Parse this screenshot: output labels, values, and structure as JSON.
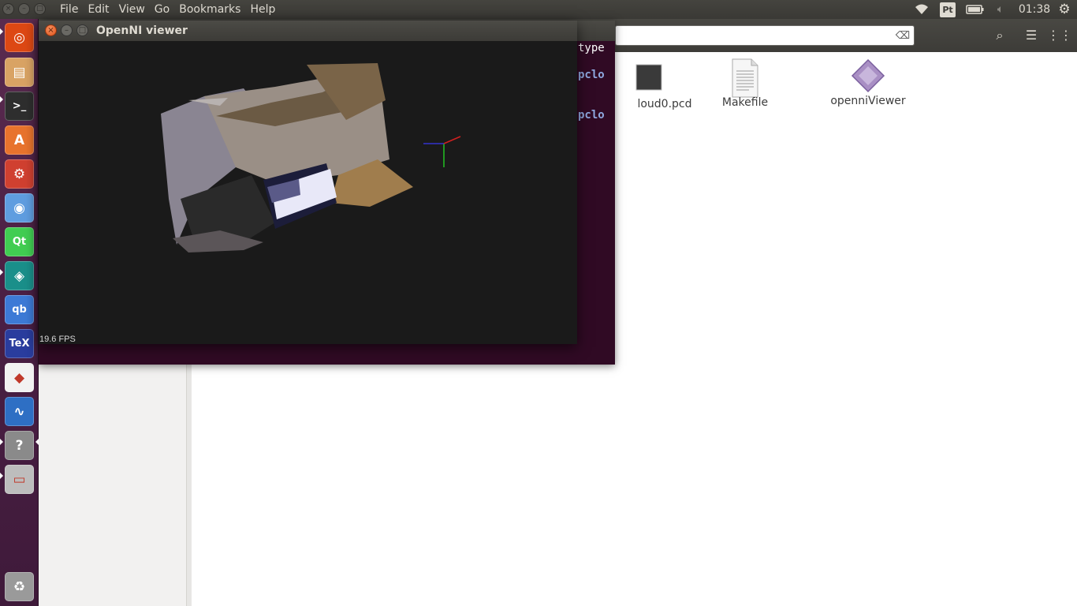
{
  "topbar": {
    "menus": [
      "File",
      "Edit",
      "View",
      "Go",
      "Bookmarks",
      "Help"
    ],
    "keyboard_layout": "Pt",
    "clock": "01:38",
    "icons": [
      "wifi-icon",
      "keyboard-layout-indicator",
      "battery-icon",
      "volume-muted-icon",
      "settings-gear-icon"
    ]
  },
  "launcher": {
    "items": [
      {
        "name": "dash-home",
        "glyph": "◎",
        "color": "#dd4814"
      },
      {
        "name": "files",
        "glyph": "▤",
        "color": "#d9a364"
      },
      {
        "name": "terminal",
        "glyph": ">_",
        "color": "#2e2e2e"
      },
      {
        "name": "software-center",
        "glyph": "A",
        "color": "#e8732d"
      },
      {
        "name": "system-settings",
        "glyph": "⚙",
        "color": "#d04030"
      },
      {
        "name": "chromium",
        "glyph": "◉",
        "color": "#5f9de0"
      },
      {
        "name": "qt-creator",
        "glyph": "Qt",
        "color": "#41cd52"
      },
      {
        "name": "gitkraken",
        "glyph": "◈",
        "color": "#1a8f8a"
      },
      {
        "name": "qbittorrent",
        "glyph": "qb",
        "color": "#3d7ad6"
      },
      {
        "name": "texmaker",
        "glyph": "TeX",
        "color": "#2a3d9e"
      },
      {
        "name": "document-viewer",
        "glyph": "◆",
        "color": "#f2f2f2"
      },
      {
        "name": "system-monitor",
        "glyph": "∿",
        "color": "#2e6fc4"
      },
      {
        "name": "help",
        "glyph": "?",
        "color": "#8a8a8a"
      },
      {
        "name": "drive",
        "glyph": "▭",
        "color": "#bdbdbd"
      }
    ],
    "trash_glyph": "♻"
  },
  "file_manager": {
    "search": {
      "value": "",
      "placeholder": ""
    },
    "files": [
      {
        "label": "loud0.pcd",
        "icon": "pcd-file-icon"
      },
      {
        "label": "Makefile",
        "icon": "text-file-icon"
      },
      {
        "label": "openniViewer",
        "icon": "executable-file-icon"
      }
    ]
  },
  "terminal": {
    "lines": [
      {
        "prefix": "",
        "text": "type"
      },
      {
        "prefix": "pclo",
        "text": ""
      },
      {
        "prefix": "pclo",
        "text": ""
      }
    ]
  },
  "viewer": {
    "title": "OpenNI viewer",
    "fps": "19.6 FPS",
    "close_glyph": "×",
    "min_glyph": "–",
    "max_glyph": "□"
  },
  "colors": {
    "panel": "#3c3b37",
    "launcher": "#4a1f44",
    "terminal_bg": "#300a24",
    "viewer_bg": "#1a1a1a",
    "close_button": "#e0531b"
  }
}
